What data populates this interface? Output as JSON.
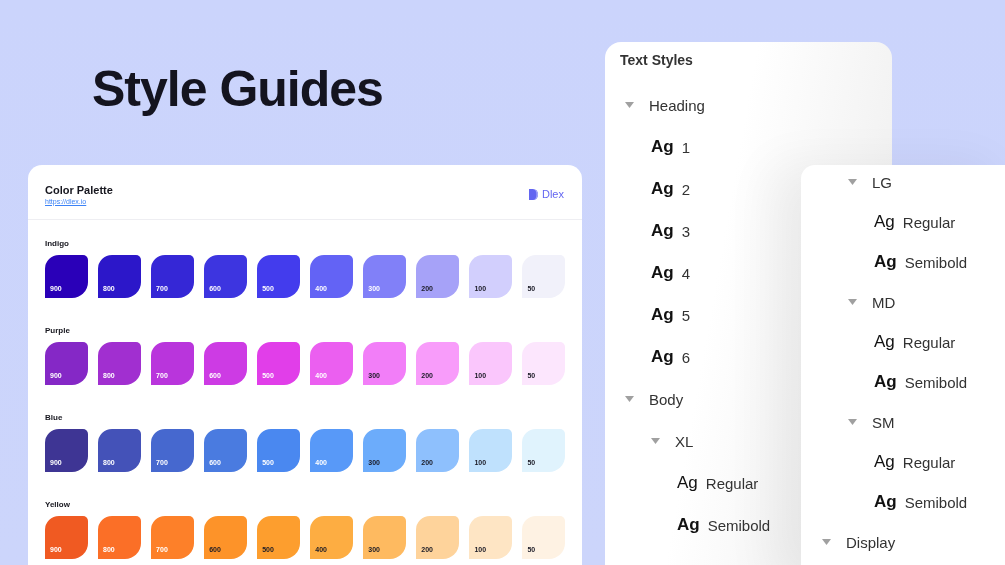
{
  "title": "Style Guides",
  "palette": {
    "title": "Color Palette",
    "link": "https://dlex.io",
    "brand": "Dlex",
    "groups": [
      {
        "name": "Indigo",
        "swatches": [
          {
            "label": "900",
            "color": "#2a00b8",
            "dark_text": false
          },
          {
            "label": "800",
            "color": "#2c17c9",
            "dark_text": false
          },
          {
            "label": "700",
            "color": "#3527d6",
            "dark_text": false
          },
          {
            "label": "600",
            "color": "#3d35e0",
            "dark_text": false
          },
          {
            "label": "500",
            "color": "#433ced",
            "dark_text": false
          },
          {
            "label": "400",
            "color": "#6363f5",
            "dark_text": false
          },
          {
            "label": "300",
            "color": "#8180f8",
            "dark_text": false
          },
          {
            "label": "200",
            "color": "#a6a2f8",
            "dark_text": true
          },
          {
            "label": "100",
            "color": "#d2cffd",
            "dark_text": true
          },
          {
            "label": "50",
            "color": "#f1f1fa",
            "dark_text": true
          }
        ]
      },
      {
        "name": "Purple",
        "swatches": [
          {
            "label": "900",
            "color": "#8528c6",
            "dark_text": false
          },
          {
            "label": "800",
            "color": "#a12fd0",
            "dark_text": false
          },
          {
            "label": "700",
            "color": "#b935dc",
            "dark_text": false
          },
          {
            "label": "600",
            "color": "#cd3be4",
            "dark_text": false
          },
          {
            "label": "500",
            "color": "#e13ee9",
            "dark_text": false
          },
          {
            "label": "400",
            "color": "#eb5ff0",
            "dark_text": false
          },
          {
            "label": "300",
            "color": "#f27ef8",
            "dark_text": true
          },
          {
            "label": "200",
            "color": "#f89cfa",
            "dark_text": true
          },
          {
            "label": "100",
            "color": "#fac6fc",
            "dark_text": true
          },
          {
            "label": "50",
            "color": "#fce6fd",
            "dark_text": true
          }
        ]
      },
      {
        "name": "Blue",
        "swatches": [
          {
            "label": "900",
            "color": "#3e3594",
            "dark_text": false
          },
          {
            "label": "800",
            "color": "#4452b8",
            "dark_text": false
          },
          {
            "label": "700",
            "color": "#4668cf",
            "dark_text": false
          },
          {
            "label": "600",
            "color": "#4a7be0",
            "dark_text": false
          },
          {
            "label": "500",
            "color": "#4a88f0",
            "dark_text": false
          },
          {
            "label": "400",
            "color": "#5899f8",
            "dark_text": false
          },
          {
            "label": "300",
            "color": "#6cacfb",
            "dark_text": true
          },
          {
            "label": "200",
            "color": "#8ec0fd",
            "dark_text": true
          },
          {
            "label": "100",
            "color": "#bfe1fd",
            "dark_text": true
          },
          {
            "label": "50",
            "color": "#e0f3fd",
            "dark_text": true
          }
        ]
      },
      {
        "name": "Yellow",
        "swatches": [
          {
            "label": "900",
            "color": "#f05a22",
            "dark_text": false
          },
          {
            "label": "800",
            "color": "#fb6f27",
            "dark_text": false
          },
          {
            "label": "700",
            "color": "#fd8029",
            "dark_text": false
          },
          {
            "label": "600",
            "color": "#fd9329",
            "dark_text": true
          },
          {
            "label": "500",
            "color": "#fd9e2e",
            "dark_text": true
          },
          {
            "label": "400",
            "color": "#fdad42",
            "dark_text": true
          },
          {
            "label": "300",
            "color": "#feba60",
            "dark_text": true
          },
          {
            "label": "200",
            "color": "#fed39b",
            "dark_text": true
          },
          {
            "label": "100",
            "color": "#fee5c4",
            "dark_text": true
          },
          {
            "label": "50",
            "color": "#fef2e3",
            "dark_text": true
          }
        ]
      }
    ]
  },
  "text_styles": {
    "title": "Text Styles",
    "items": [
      {
        "kind": "group",
        "label": "Heading",
        "expanded": true,
        "children": [
          {
            "kind": "sample",
            "sample": "Ag",
            "label": "1",
            "bold": true
          },
          {
            "kind": "sample",
            "sample": "Ag",
            "label": "2",
            "bold": true
          },
          {
            "kind": "sample",
            "sample": "Ag",
            "label": "3",
            "bold": true
          },
          {
            "kind": "sample",
            "sample": "Ag",
            "label": "4",
            "bold": true
          },
          {
            "kind": "sample",
            "sample": "Ag",
            "label": "5",
            "bold": true
          },
          {
            "kind": "sample",
            "sample": "Ag",
            "label": "6",
            "bold": true
          }
        ]
      },
      {
        "kind": "group",
        "label": "Body",
        "expanded": true,
        "children": [
          {
            "kind": "group",
            "label": "XL",
            "expanded": true,
            "children": [
              {
                "kind": "sample",
                "sample": "Ag",
                "label": "Regular",
                "bold": false
              },
              {
                "kind": "sample",
                "sample": "Ag",
                "label": "Semibold",
                "bold": true
              }
            ]
          }
        ]
      }
    ]
  },
  "text_styles_continued": {
    "items": [
      {
        "kind": "continuation",
        "children": [
          {
            "kind": "group",
            "label": "LG",
            "expanded": true,
            "children": [
              {
                "kind": "sample",
                "sample": "Ag",
                "label": "Regular",
                "bold": false
              },
              {
                "kind": "sample",
                "sample": "Ag",
                "label": "Semibold",
                "bold": true
              }
            ]
          },
          {
            "kind": "group",
            "label": "MD",
            "expanded": true,
            "children": [
              {
                "kind": "sample",
                "sample": "Ag",
                "label": "Regular",
                "bold": false
              },
              {
                "kind": "sample",
                "sample": "Ag",
                "label": "Semibold",
                "bold": true
              }
            ]
          },
          {
            "kind": "group",
            "label": "SM",
            "expanded": true,
            "children": [
              {
                "kind": "sample",
                "sample": "Ag",
                "label": "Regular",
                "bold": false
              },
              {
                "kind": "sample",
                "sample": "Ag",
                "label": "Semibold",
                "bold": true
              }
            ]
          }
        ]
      },
      {
        "kind": "group",
        "label": "Display",
        "expanded": true
      }
    ]
  }
}
